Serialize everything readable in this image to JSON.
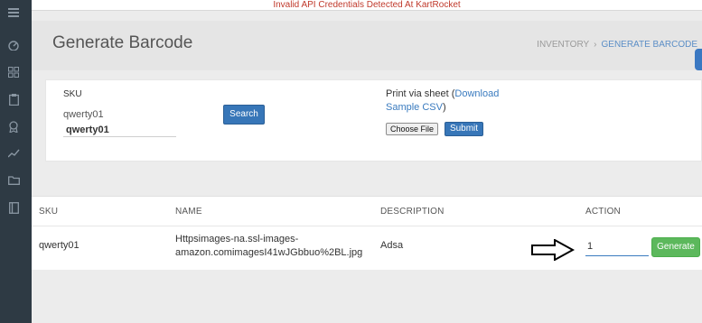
{
  "alert": {
    "message": "Invalid API Credentials Detected At KartRocket"
  },
  "sidebar": {
    "icons": [
      "menu-icon",
      "dashboard-icon",
      "grid-icon",
      "clipboard-icon",
      "award-icon",
      "chart-icon",
      "folder-icon",
      "book-icon"
    ]
  },
  "header": {
    "title": "Generate Barcode",
    "breadcrumb": [
      "INVENTORY",
      "GENERATE BARCODE"
    ]
  },
  "search_form": {
    "sku_label": "SKU",
    "sku_value": "qwerty01",
    "sku_input_value": "qwerty01",
    "search_label": "Search"
  },
  "print_form": {
    "text_prefix": "Print via sheet (",
    "link_label": "Download Sample CSV",
    "text_suffix": ")",
    "choose_file_label": "Choose File",
    "submit_label": "Submit"
  },
  "table": {
    "headers": {
      "sku": "SKU",
      "name": "NAME",
      "description": "DESCRIPTION",
      "action": "ACTION"
    },
    "rows": [
      {
        "sku": "qwerty01",
        "name_line1": "Httpsimages-na.ssl-images-",
        "name_line2": "amazon.comimagesI41wJGbbuo%2BL.jpg",
        "description": "Adsa",
        "quantity": "1",
        "generate_label": "Generate"
      }
    ]
  },
  "colors": {
    "sidebar": "#2e3a44",
    "alert": "#c0392b",
    "primary": "#3776b8",
    "success": "#5cb85c",
    "link": "#3a7bbf"
  }
}
